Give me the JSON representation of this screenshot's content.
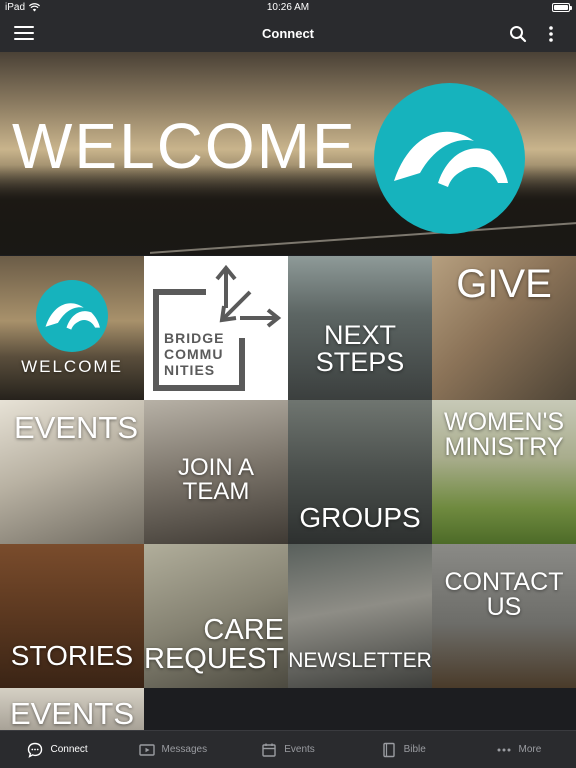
{
  "status_bar": {
    "device": "iPad",
    "time": "10:26 AM"
  },
  "nav": {
    "title": "Connect",
    "icons": [
      "hamburger-menu-icon",
      "search-icon",
      "more-vertical-icon"
    ]
  },
  "hero": {
    "text": "WELCOME"
  },
  "tiles": [
    {
      "label": "WELCOME"
    },
    {
      "label_lines": [
        "BRIDGE",
        "COMMU",
        "NITIES"
      ]
    },
    {
      "label": "NEXT STEPS"
    },
    {
      "label": "GIVE"
    },
    {
      "label": "EVENTS"
    },
    {
      "label_lines": [
        "JOIN A",
        "TEAM"
      ]
    },
    {
      "label": "GROUPS"
    },
    {
      "label_lines": [
        "WOMEN'S",
        "MINISTRY"
      ]
    },
    {
      "label": "STORIES"
    },
    {
      "label_lines": [
        "CARE",
        "REQUEST"
      ]
    },
    {
      "label": "NEWSLETTER"
    },
    {
      "label_lines": [
        "CONTACT",
        "US"
      ]
    },
    {
      "label": "EVENTS"
    }
  ],
  "tab_bar": [
    {
      "label": "Connect",
      "icon": "chat-bubble-icon",
      "active": true
    },
    {
      "label": "Messages",
      "icon": "video-play-icon",
      "active": false
    },
    {
      "label": "Events",
      "icon": "calendar-icon",
      "active": false
    },
    {
      "label": "Bible",
      "icon": "book-icon",
      "active": false
    },
    {
      "label": "More",
      "icon": "more-horizontal-icon",
      "active": false
    }
  ],
  "colors": {
    "brand_teal": "#16b3bd",
    "bar_background": "#2a2b2e"
  }
}
